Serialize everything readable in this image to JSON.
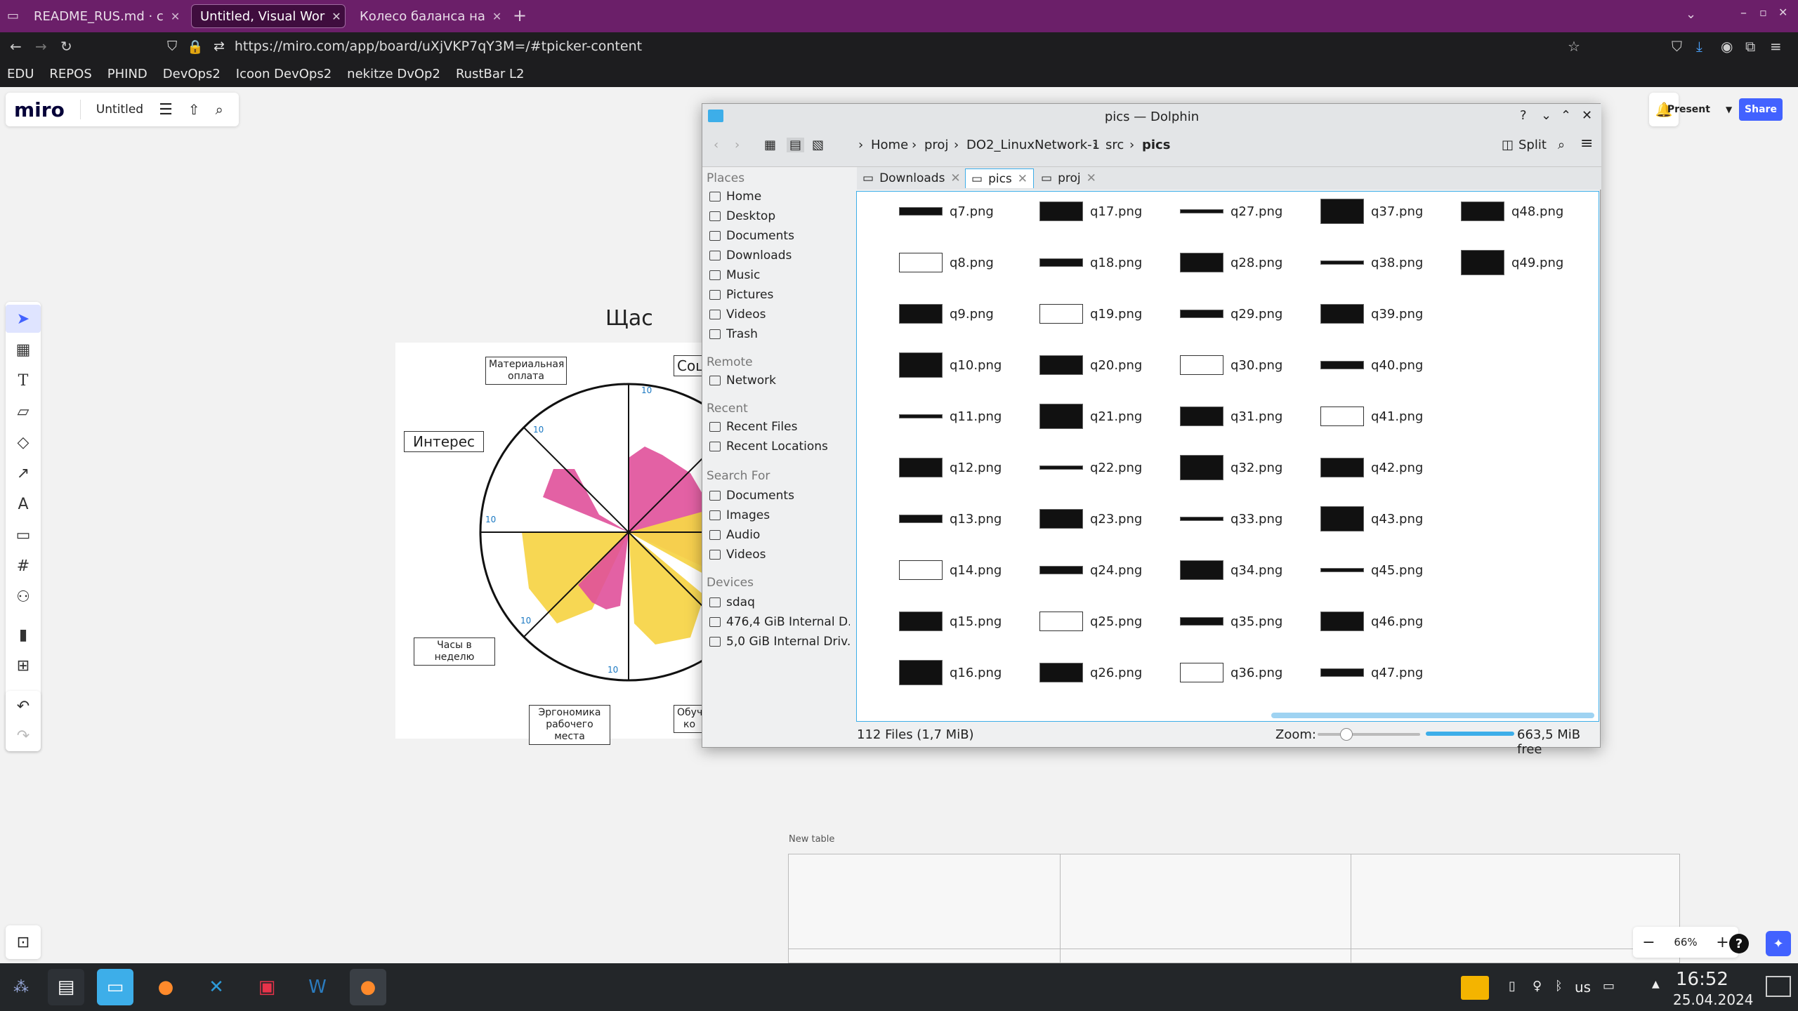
{
  "browser": {
    "tabs": [
      {
        "label": "README_RUS.md · c"
      },
      {
        "label": "Untitled, Visual Wor"
      },
      {
        "label": "Колесо баланса на"
      }
    ],
    "url": "https://miro.com/app/board/uXjVKP7qY3M=/#tpicker-content",
    "bookmarks": [
      "EDU",
      "REPOS",
      "PHIND",
      "DevOps2",
      "Icoon DevOps2",
      "nekitze DvOp2",
      "RustBar L2"
    ]
  },
  "miro": {
    "logo": "miro",
    "board_title": "Untitled",
    "present_label": "Present",
    "share_label": "Share",
    "zoom": "66%",
    "table_label": "New table",
    "help": "?"
  },
  "wheel": {
    "title": "Щас",
    "labels": {
      "material": "Материальная оплата",
      "interest": "Интерес",
      "social": "Соц",
      "hours": "Часы в неделю",
      "ergonomics": "Эргономика рабочего места",
      "learning": "Обуче ко"
    },
    "ticks": "10",
    "colors": {
      "pink": "#e0509a",
      "yellow": "#f7d54a"
    }
  },
  "dolphin": {
    "title": "pics — Dolphin",
    "breadcrumb": [
      "Home",
      "proj",
      "DO2_LinuxNetwork-1",
      "src",
      "pics"
    ],
    "split_label": "Split",
    "places_header": "Places",
    "places": [
      "Home",
      "Desktop",
      "Documents",
      "Downloads",
      "Music",
      "Pictures",
      "Videos",
      "Trash"
    ],
    "remote_header": "Remote",
    "remote": [
      "Network"
    ],
    "recent_header": "Recent",
    "recent": [
      "Recent Files",
      "Recent Locations"
    ],
    "search_header": "Search For",
    "search": [
      "Documents",
      "Images",
      "Audio",
      "Videos"
    ],
    "devices_header": "Devices",
    "devices": [
      "sdaq",
      "476,4 GiB Internal D...",
      "5,0 GiB Internal Driv..."
    ],
    "tabs": [
      "Downloads",
      "pics",
      "proj"
    ],
    "files": [
      [
        "q7.png",
        "q17.png",
        "q27.png",
        "q37.png",
        "q48.png"
      ],
      [
        "q8.png",
        "q18.png",
        "q28.png",
        "q38.png",
        "q49.png"
      ],
      [
        "q9.png",
        "q19.png",
        "q29.png",
        "q39.png"
      ],
      [
        "q10.png",
        "q20.png",
        "q30.png",
        "q40.png"
      ],
      [
        "q11.png",
        "q21.png",
        "q31.png",
        "q41.png"
      ],
      [
        "q12.png",
        "q22.png",
        "q32.png",
        "q42.png"
      ],
      [
        "q13.png",
        "q23.png",
        "q33.png",
        "q43.png"
      ],
      [
        "q14.png",
        "q24.png",
        "q34.png",
        "q45.png"
      ],
      [
        "q15.png",
        "q25.png",
        "q35.png",
        "q46.png"
      ],
      [
        "q16.png",
        "q26.png",
        "q36.png",
        "q47.png"
      ]
    ],
    "status_count": "112 Files (1,7 MiB)",
    "zoom_label": "Zoom:",
    "free_space": "663,5 MiB free"
  },
  "taskbar": {
    "time": "16:52",
    "date": "25.04.2024",
    "keyboard": "us"
  }
}
